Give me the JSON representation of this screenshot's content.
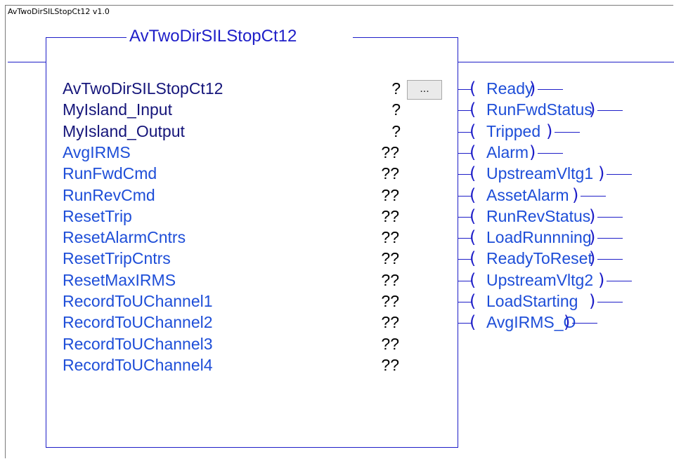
{
  "caption": "AvTwoDirSILStopCt12 v1.0",
  "block": {
    "title": "AvTwoDirSILStopCt12",
    "browse_button_label": "...",
    "params": [
      {
        "name": "AvTwoDirSILStopCt12",
        "value": "?",
        "style": "header"
      },
      {
        "name": "MyIsland_Input",
        "value": "?",
        "style": "header"
      },
      {
        "name": "MyIsland_Output",
        "value": "?",
        "style": "header"
      },
      {
        "name": "AvgIRMS",
        "value": "??",
        "style": "pin"
      },
      {
        "name": "RunFwdCmd",
        "value": "??",
        "style": "pin"
      },
      {
        "name": "RunRevCmd",
        "value": "??",
        "style": "pin"
      },
      {
        "name": "ResetTrip",
        "value": "??",
        "style": "pin"
      },
      {
        "name": "ResetAlarmCntrs",
        "value": "??",
        "style": "pin"
      },
      {
        "name": "ResetTripCntrs",
        "value": "??",
        "style": "pin"
      },
      {
        "name": "ResetMaxIRMS",
        "value": "??",
        "style": "pin"
      },
      {
        "name": "RecordToUChannel1",
        "value": "??",
        "style": "pin"
      },
      {
        "name": "RecordToUChannel2",
        "value": "??",
        "style": "pin"
      },
      {
        "name": "RecordToUChannel3",
        "value": "??",
        "style": "pin"
      },
      {
        "name": "RecordToUChannel4",
        "value": "??",
        "style": "pin"
      }
    ]
  },
  "outputs": [
    "Ready",
    "RunFwdStatus",
    "Tripped",
    "Alarm",
    "UpstreamVltg1",
    "AssetAlarm",
    "RunRevStatus",
    "LoadRunnning",
    "ReadyToReset",
    "UpstreamVltg2",
    "LoadStarting",
    "AvgIRMS_O"
  ],
  "colors": {
    "wire": "#1e1ec8",
    "header_text": "#15157a",
    "pin_text": "#1e4ed8"
  }
}
